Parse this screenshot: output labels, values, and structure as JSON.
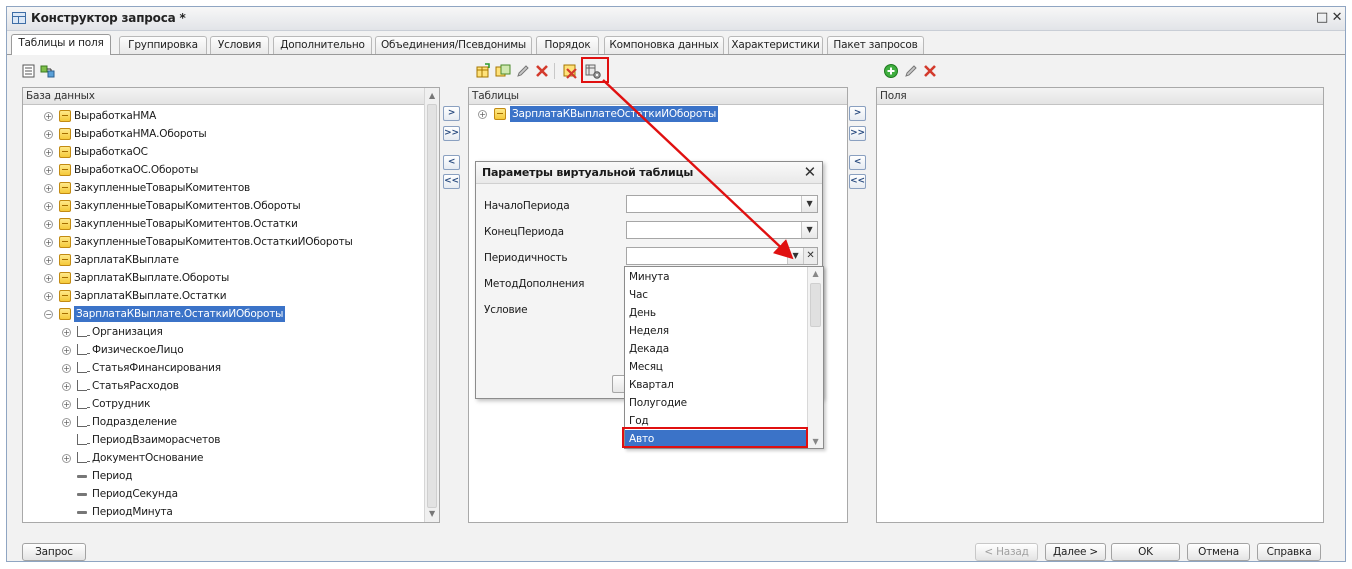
{
  "window": {
    "title": "Конструктор запроса *",
    "window_btns": [
      "□",
      "✕"
    ]
  },
  "tabs": [
    {
      "label": "Таблицы и поля",
      "active": true
    },
    {
      "label": "Группировка"
    },
    {
      "label": "Условия"
    },
    {
      "label": "Дополнительно"
    },
    {
      "label": "Объединения/Псевдонимы"
    },
    {
      "label": "Порядок"
    },
    {
      "label": "Компоновка данных"
    },
    {
      "label": "Характеристики"
    },
    {
      "label": "Пакет запросов"
    }
  ],
  "database_panel": {
    "header": "База данных",
    "items": [
      {
        "label": "ВыработкаНМА",
        "type": "table"
      },
      {
        "label": "ВыработкаНМА.Обороты",
        "type": "table"
      },
      {
        "label": "ВыработкаОС",
        "type": "table"
      },
      {
        "label": "ВыработкаОС.Обороты",
        "type": "table"
      },
      {
        "label": "ЗакупленныеТоварыКомитентов",
        "type": "table"
      },
      {
        "label": "ЗакупленныеТоварыКомитентов.Обороты",
        "type": "table"
      },
      {
        "label": "ЗакупленныеТоварыКомитентов.Остатки",
        "type": "table"
      },
      {
        "label": "ЗакупленныеТоварыКомитентов.ОстаткиИОбороты",
        "type": "table"
      },
      {
        "label": "ЗарплатаКВыплате",
        "type": "table"
      },
      {
        "label": "ЗарплатаКВыплате.Обороты",
        "type": "table"
      },
      {
        "label": "ЗарплатаКВыплате.Остатки",
        "type": "table"
      },
      {
        "label": "ЗарплатаКВыплате.ОстаткиИОбороты",
        "type": "table",
        "selected": true,
        "expanded": true
      },
      {
        "label": "Организация",
        "type": "field"
      },
      {
        "label": "ФизическоеЛицо",
        "type": "field"
      },
      {
        "label": "СтатьяФинансирования",
        "type": "field"
      },
      {
        "label": "СтатьяРасходов",
        "type": "field"
      },
      {
        "label": "Сотрудник",
        "type": "field"
      },
      {
        "label": "Подразделение",
        "type": "field"
      },
      {
        "label": "ПериодВзаиморасчетов",
        "type": "field-noexp"
      },
      {
        "label": "ДокументОснование",
        "type": "field"
      },
      {
        "label": "Период",
        "type": "attr"
      },
      {
        "label": "ПериодСекунда",
        "type": "attr"
      },
      {
        "label": "ПериодМинута",
        "type": "attr"
      }
    ]
  },
  "move_buttons": [
    ">",
    ">>",
    "<",
    "<<"
  ],
  "tables_panel": {
    "header": "Таблицы",
    "items": [
      {
        "label": "ЗарплатаКВыплатеОстаткиИОбороты",
        "selected": true
      }
    ]
  },
  "fields_panel": {
    "header": "Поля"
  },
  "dialog": {
    "title": "Параметры виртуальной таблицы",
    "close": "✕",
    "fields": [
      {
        "label": "НачалоПериода"
      },
      {
        "label": "КонецПериода"
      },
      {
        "label": "Периодичность"
      },
      {
        "label": "МетодДополнения"
      },
      {
        "label": "Условие"
      }
    ]
  },
  "periodicity_dropdown": {
    "options": [
      "Минута",
      "Час",
      "День",
      "Неделя",
      "Декада",
      "Месяц",
      "Квартал",
      "Полугодие",
      "Год",
      "Авто"
    ],
    "selected": "Авто"
  },
  "bottom_buttons": {
    "query": "Запрос",
    "back": "< Назад",
    "next": "Далее >",
    "ok": "OK",
    "cancel": "Отмена",
    "help": "Справка"
  },
  "colors": {
    "selection": "#3b73c8",
    "highlight": "#e01010",
    "window_border": "#8fa5c2"
  }
}
